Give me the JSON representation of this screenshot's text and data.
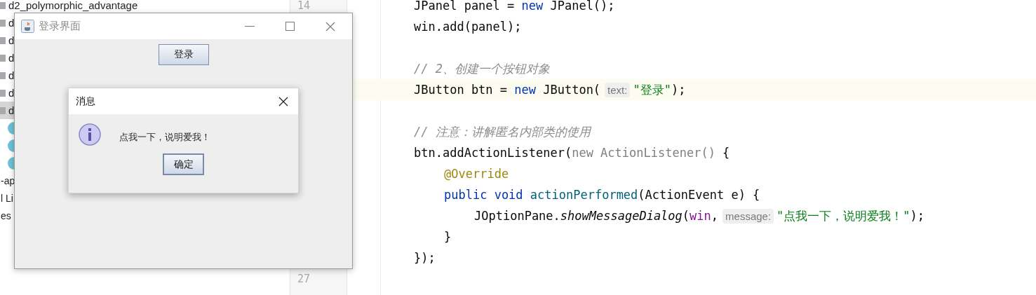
{
  "project_tree": {
    "items": [
      {
        "kind": "folder",
        "label": "d2_polymorphic_advantage",
        "selected": false
      },
      {
        "kind": "folder",
        "label": "d",
        "selected": false
      },
      {
        "kind": "folder",
        "label": "d",
        "selected": false
      },
      {
        "kind": "folder",
        "label": "d",
        "selected": false
      },
      {
        "kind": "folder",
        "label": "d",
        "selected": false
      },
      {
        "kind": "folder",
        "label": "d",
        "selected": false
      },
      {
        "kind": "folder",
        "label": "d",
        "selected": true
      },
      {
        "kind": "class",
        "selected": false
      },
      {
        "kind": "class",
        "selected": false
      },
      {
        "kind": "class",
        "selected": false
      },
      {
        "kind": "text",
        "label": "-ap",
        "selected": false
      },
      {
        "kind": "text",
        "label": "l Li",
        "selected": false
      },
      {
        "kind": "text",
        "label": "es",
        "selected": false
      }
    ]
  },
  "editor": {
    "lines": [
      {
        "number": "14",
        "current": false,
        "tokens": [
          {
            "kind": "plain",
            "text": "JPanel panel ="
          },
          {
            "kind": "keyword",
            "text": "new"
          },
          {
            "kind": "plain",
            "text": "JPanel();"
          }
        ]
      },
      {
        "current": false,
        "tokens": [
          {
            "kind": "plain",
            "text": "win.add(panel);"
          }
        ]
      },
      {
        "current": false
      },
      {
        "current": false,
        "tokens": [
          {
            "kind": "comment",
            "text": "// 2、创建一个按钮对象"
          }
        ]
      },
      {
        "current": true,
        "tokens": [
          {
            "kind": "plain",
            "text": "JButton btn ="
          },
          {
            "kind": "keyword",
            "text": "new"
          },
          {
            "kind": "plain",
            "text": "JButton("
          },
          {
            "kind": "hint",
            "text": "text:"
          },
          {
            "kind": "string",
            "text": "\"登录\""
          },
          {
            "kind": "plain",
            "text": ");"
          }
        ]
      },
      {
        "current": false
      },
      {
        "current": false,
        "tokens": [
          {
            "kind": "comment",
            "text": "// 注意：讲解匿名内部类的使用"
          }
        ]
      },
      {
        "current": false,
        "tokens": [
          {
            "kind": "plain",
            "text": "btn.addActionListener("
          },
          {
            "kind": "dim",
            "text": "new ActionListener()"
          },
          {
            "kind": "plain",
            "text": "{"
          }
        ],
        "children": [
          {
            "current": false,
            "tokens": [
              {
                "kind": "annotation",
                "text": "@Override"
              }
            ]
          },
          {
            "current": false,
            "tokens": [
              {
                "kind": "keyword",
                "text": "public void"
              },
              {
                "kind": "method",
                "text": "actionPerformed"
              },
              {
                "kind": "plain",
                "text": "(ActionEvent e) {"
              }
            ],
            "children": [
              {
                "current": false,
                "tokens": [
                  {
                    "kind": "plain",
                    "text": "JOptionPane."
                  },
                  {
                    "kind": "italic",
                    "text": "showMessageDialog"
                  },
                  {
                    "kind": "plain",
                    "text": "("
                  },
                  {
                    "kind": "param",
                    "text": "win"
                  },
                  {
                    "kind": "plain",
                    "text": ","
                  },
                  {
                    "kind": "hint",
                    "text": "message:"
                  },
                  {
                    "kind": "string",
                    "text": "\"点我一下，说明爱我！\""
                  },
                  {
                    "kind": "plain",
                    "text": ");"
                  }
                ]
              }
            ]
          },
          {
            "current": false,
            "tokens": [
              {
                "kind": "plain",
                "text": "}"
              }
            ]
          }
        ]
      },
      {
        "current": false,
        "tokens": [
          {
            "kind": "plain",
            "text": "});"
          }
        ]
      },
      {
        "number": "27",
        "current": false
      }
    ]
  },
  "app_window": {
    "title": "登录界面",
    "button": "登录"
  },
  "message_dialog": {
    "title": "消息",
    "message": "点我一下，说明爱我！",
    "button": "确定"
  }
}
